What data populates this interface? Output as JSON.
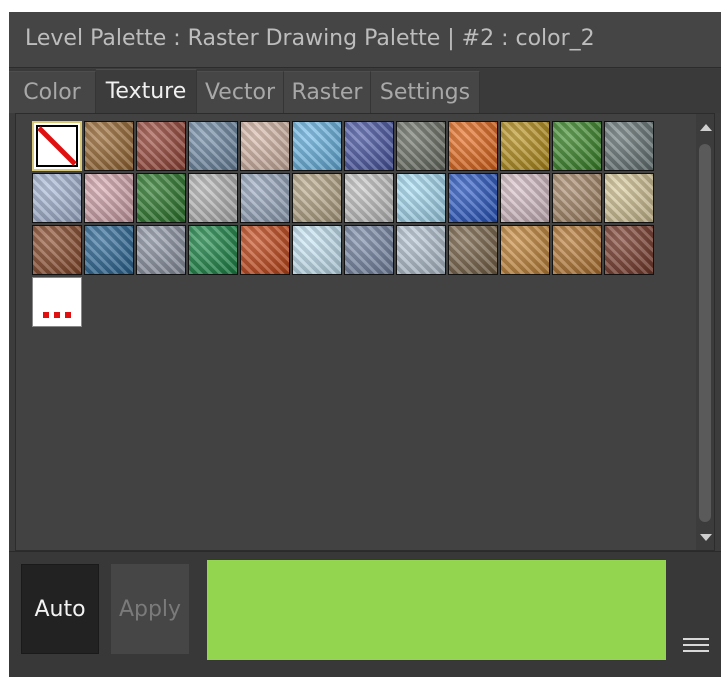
{
  "palette": {
    "title": "Level Palette : Raster Drawing Palette | #2 : color_2"
  },
  "tabs": [
    {
      "label": "Color",
      "active": false
    },
    {
      "label": "Texture",
      "active": true
    },
    {
      "label": "Vector",
      "active": false
    },
    {
      "label": "Raster",
      "active": false
    },
    {
      "label": "Settings",
      "active": false
    }
  ],
  "textures": [
    {
      "icon": "none-texture-icon",
      "color": "#ffffff"
    },
    {
      "icon": "leopard-texture-icon",
      "color": "#9c6a32"
    },
    {
      "icon": "brick-texture-icon",
      "color": "#9a4638"
    },
    {
      "icon": "kaleidoscope-texture-icon",
      "color": "#6e8aa6"
    },
    {
      "icon": "checker-texture-icon",
      "color": "#d8b8a8"
    },
    {
      "icon": "sky-texture-icon",
      "color": "#6ab8e8"
    },
    {
      "icon": "denim-texture-icon",
      "color": "#4a58a8"
    },
    {
      "icon": "rock-texture-icon",
      "color": "#6a7064"
    },
    {
      "icon": "fire-texture-icon",
      "color": "#e86818"
    },
    {
      "icon": "gold-texture-icon",
      "color": "#b89018"
    },
    {
      "icon": "grass-texture-icon",
      "color": "#3a8a28"
    },
    {
      "icon": "granite-texture-icon",
      "color": "#6a7878"
    },
    {
      "icon": "plaid-texture-icon",
      "color": "#a8b8d8"
    },
    {
      "icon": "fabric-texture-icon",
      "color": "#d8a8b0"
    },
    {
      "icon": "leaves-texture-icon",
      "color": "#2a7a2a"
    },
    {
      "icon": "marble-texture-icon",
      "color": "#b8b8b8"
    },
    {
      "icon": "frost-texture-icon",
      "color": "#98a8c0"
    },
    {
      "icon": "sand-texture-icon",
      "color": "#b8a888"
    },
    {
      "icon": "crumpled-paper-texture-icon",
      "color": "#c8c8c8"
    },
    {
      "icon": "light-blue-texture-icon",
      "color": "#a8e0f8"
    },
    {
      "icon": "blue-tile-texture-icon",
      "color": "#2858c8"
    },
    {
      "icon": "lace-texture-icon",
      "color": "#d8c0c8"
    },
    {
      "icon": "stone-wall-texture-icon",
      "color": "#a88868"
    },
    {
      "icon": "burlap-texture-icon",
      "color": "#d8c898"
    },
    {
      "icon": "wood-brown-texture-icon",
      "color": "#8a4a2a"
    },
    {
      "icon": "water-texture-icon",
      "color": "#2a6898"
    },
    {
      "icon": "chrome-texture-icon",
      "color": "#9098a8"
    },
    {
      "icon": "emerald-texture-icon",
      "color": "#1a8a48"
    },
    {
      "icon": "lava-texture-icon",
      "color": "#c84818"
    },
    {
      "icon": "glow-texture-icon",
      "color": "#c8e8f8"
    },
    {
      "icon": "slate-texture-icon",
      "color": "#7888a8"
    },
    {
      "icon": "ice-texture-icon",
      "color": "#b8c8d8"
    },
    {
      "icon": "pebbles-texture-icon",
      "color": "#7a6448"
    },
    {
      "icon": "pine-wood-texture-icon",
      "color": "#c88838"
    },
    {
      "icon": "oak-wood-texture-icon",
      "color": "#b87830"
    },
    {
      "icon": "dark-wood-texture-icon",
      "color": "#7a3a2a"
    },
    {
      "icon": "more-textures-icon",
      "color": "#ffffff"
    }
  ],
  "bottom": {
    "auto_label": "Auto",
    "apply_label": "Apply",
    "current_color": "#94d550"
  }
}
